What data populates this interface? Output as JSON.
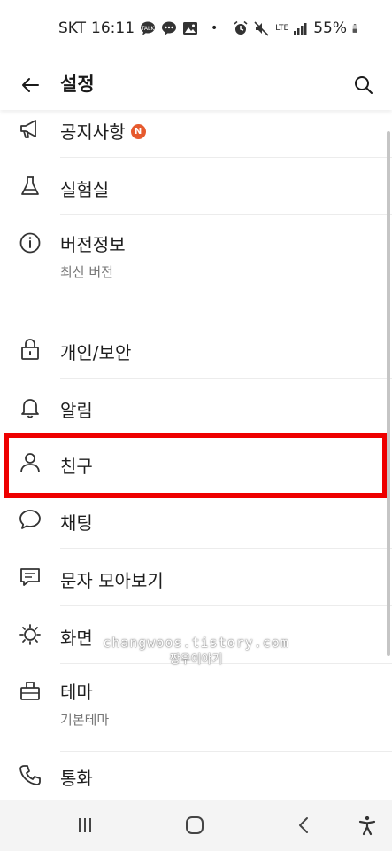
{
  "status_bar": {
    "carrier": "SKT",
    "time": "16:11",
    "network": "LTE",
    "battery": "55%",
    "left_icons": [
      "talk-icon",
      "chat-bubble-icon",
      "gallery-icon"
    ],
    "right_icons": [
      "alarm-icon",
      "mute-icon",
      "signal-icon",
      "battery-icon"
    ]
  },
  "app_bar": {
    "title": "설정",
    "back_icon": "arrow-left-icon",
    "search_icon": "search-icon"
  },
  "list": {
    "section1": [
      {
        "icon": "megaphone-icon",
        "label": "공지사항",
        "badge": "N"
      },
      {
        "icon": "flask-icon",
        "label": "실험실"
      },
      {
        "icon": "info-icon",
        "label": "버전정보",
        "sub": "최신 버전"
      }
    ],
    "section2": [
      {
        "icon": "lock-icon",
        "label": "개인/보안"
      },
      {
        "icon": "bell-icon",
        "label": "알림"
      },
      {
        "icon": "person-icon",
        "label": "친구",
        "highlighted": true
      },
      {
        "icon": "speech-bubble-icon",
        "label": "채팅"
      },
      {
        "icon": "message-box-icon",
        "label": "문자 모아보기"
      },
      {
        "icon": "display-icon",
        "label": "화면"
      },
      {
        "icon": "theme-icon",
        "label": "테마",
        "sub": "기본테마"
      },
      {
        "icon": "phone-icon",
        "label": "통화"
      }
    ]
  },
  "highlight_color": "#ee0000",
  "badge_color": "#e65a2e",
  "watermark": {
    "line1": "changwoos.tistory.com",
    "line2": "짱우이야기"
  },
  "nav_bar": {
    "buttons": [
      "recent-apps-icon",
      "home-icon",
      "back-icon",
      "accessibility-icon"
    ]
  }
}
